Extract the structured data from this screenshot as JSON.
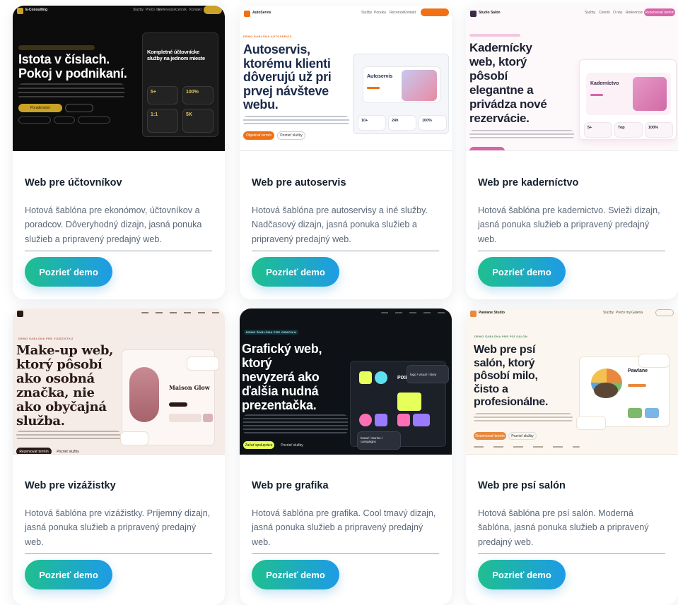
{
  "button_label": "Pozrieť demo",
  "cards": [
    {
      "title": "Web pre účtovníkov",
      "desc": "Hotová šablóna pre ekonómov, účtovníkov a poradcov. Dôveryhodný dizajn, jasná ponuka služieb a pripravený predajný web.",
      "preview": {
        "brand": "E-Consulting",
        "nav": [
          "Služby",
          "Prečo my",
          "Referencie",
          "Cenník",
          "Kontakt"
        ],
        "hero_title": "Istota v číslach.\nPokoj v podnikaní.",
        "panel_title": "Kompletné účtovnícke\nslužby na jednom mieste",
        "stats": [
          "5+",
          "100%",
          "1:1",
          "5K"
        ],
        "cta": "Poradenstvo",
        "accent": "#c9a227"
      }
    },
    {
      "title": "Web pre autoservis",
      "desc": "Hotová šablóna pre autoservisy a iné služby. Nadčasový dizajn, jasná ponuka služieb a pripravený predajný web.",
      "preview": {
        "brand": "AutoServis",
        "nav": [
          "Služby",
          "Ponuka",
          "Recenzie",
          "Kontakt"
        ],
        "hero_tag": "DEMO ŠABLÓNA AUTOSERVIS",
        "hero_title": "Autoservis,\nktorému klienti\ndôverujú už pri\nprvej návšteve\nwebu.",
        "panel_title": "Autoservis",
        "cta": "Objednať termín",
        "cta2": "Pozrieť služby",
        "stats": [
          "10+",
          "24h",
          "100%"
        ],
        "accent": "#f07016"
      }
    },
    {
      "title": "Web pre kaderníctvo",
      "desc": "Hotová šablóna pre kadernictvo. Svieži dizajn, jasná ponuka služieb a pripravený predajný web.",
      "preview": {
        "brand": "Studio Salón",
        "nav": [
          "Služby",
          "Cenník",
          "O nás",
          "Referencie"
        ],
        "cta": "Rezervovať termín",
        "hero_title": "Kadernícky\nweb, ktorý\npôsobí\nelegantne a\nprivádza nové\nrezervácie.",
        "panel_title": "Kaderníctvo",
        "stats": [
          "5+",
          "Top",
          "100%"
        ],
        "accent": "#d864a8"
      }
    },
    {
      "title": "Web pre vizážistky",
      "desc": "Hotová šablóna pre vizážistky. Príjemný dizajn, jasná ponuka služieb a pripravený predajný web.",
      "preview": {
        "hero_tag": "DEMO ŠABLÓNA PRE VIZÁŽISTKU",
        "hero_title": "Make-up web,\nktorý pôsobí\nako osobná\nznačka, nie\nako obyčajná\nslužba.",
        "panel_title": "Maison Glow",
        "cta": "Rezervovať termín",
        "cta2": "Pozrieť služby",
        "accent": "#2a1a16"
      }
    },
    {
      "title": "Web pre grafika",
      "desc": "Hotová šablóna pre grafika. Cool tmavý dizajn, jasná ponuka služieb a pripravený predajný web.",
      "preview": {
        "hero_tag": "DEMO ŠABLÓNA PRE GRAFIKA",
        "hero_title": "Grafický web,\nktorý\nnevyzerá ako\nďalšia nudná\nprezentačka.",
        "panel_title": "PIXE",
        "chip1": "logo / visual / story",
        "chip2": "brand / stories /\ncampaigns",
        "cta": "Začať spoluprácu",
        "cta2": "Pozrieť služby",
        "accent": "#e6ff5a"
      }
    },
    {
      "title": "Web pre psí salón",
      "desc": "Hotová šablóna pre psí salón. Moderná šablóna, jasná ponuka služieb a pripravený predajný web.",
      "preview": {
        "brand": "Pawlane Studio",
        "nav": [
          "Služby",
          "Prečo my",
          "Galéria"
        ],
        "hero_tag": "DEMO ŠABLÓNA PRE PSÍ SALÓN",
        "hero_title": "Web pre psí\nsalón, ktorý\npôsobí milo,\nčisto a\nprofesionálne.",
        "panel_title": "Pawlane",
        "cta": "Rezervovať termín",
        "cta2": "Pozrieť služby",
        "accent": "#e8893e"
      }
    }
  ]
}
